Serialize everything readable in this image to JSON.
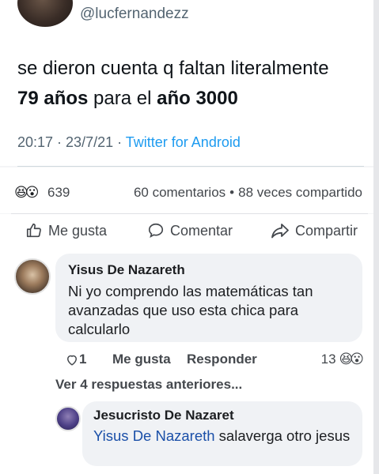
{
  "tweet": {
    "handle": "@lucfernandezz",
    "text_line1": "se dieron cuenta q faltan literalmente",
    "text_bold1": "79 años",
    "text_mid": " para el ",
    "text_bold2": "año 3000",
    "time": "20:17",
    "date": "23/7/21",
    "source": "Twitter for Android",
    "sep": " · "
  },
  "reactions": {
    "emojis": "😆😮",
    "count": "639",
    "comments": "60 comentarios",
    "shares": "88 veces compartido",
    "dot": "•"
  },
  "actions": {
    "like": "Me gusta",
    "comment": "Comentar",
    "share": "Compartir"
  },
  "comments": [
    {
      "author": "Yisus De Nazareth",
      "text": "Ni yo comprendo las matemáticas tan avanzadas que uso esta chica para calcularlo",
      "share_count": "1",
      "like_label": "Me gusta",
      "reply_label": "Responder",
      "reaction_count": "13",
      "reaction_emojis": "😆😮"
    }
  ],
  "more_replies": "Ver 4 respuestas anteriores...",
  "reply": {
    "author": "Jesucristo De Nazaret",
    "mention": "Yisus De Nazareth",
    "text": " salaverga otro jesus"
  },
  "colors": {
    "link_blue": "#1d9bf0",
    "mention_blue": "#1a4fa8",
    "bubble_bg": "#f0f2f5"
  }
}
